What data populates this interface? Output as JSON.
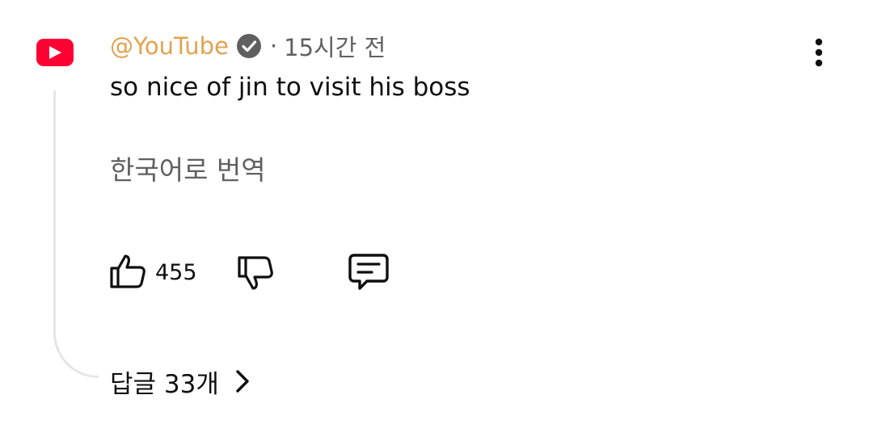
{
  "comment": {
    "author_handle": "@YouTube",
    "separator": "·",
    "time": "15시간 전",
    "text": "so nice of jin to visit his boss",
    "translate_label": "한국어로 번역"
  },
  "actions": {
    "like_count": "455"
  },
  "replies": {
    "label": "답글 33개"
  },
  "colors": {
    "handle": "#e0a34f",
    "avatar_bg": "#ff0033",
    "secondary_text": "#606060",
    "primary_text": "#0f0f0f",
    "thread_line": "#e5e5e5"
  },
  "icons": {
    "avatar": "youtube-logo-icon",
    "verified": "verified-check-icon",
    "more": "more-vertical-icon",
    "like": "thumbs-up-icon",
    "dislike": "thumbs-down-icon",
    "reply": "comment-reply-icon",
    "chevron": "chevron-right-icon"
  }
}
